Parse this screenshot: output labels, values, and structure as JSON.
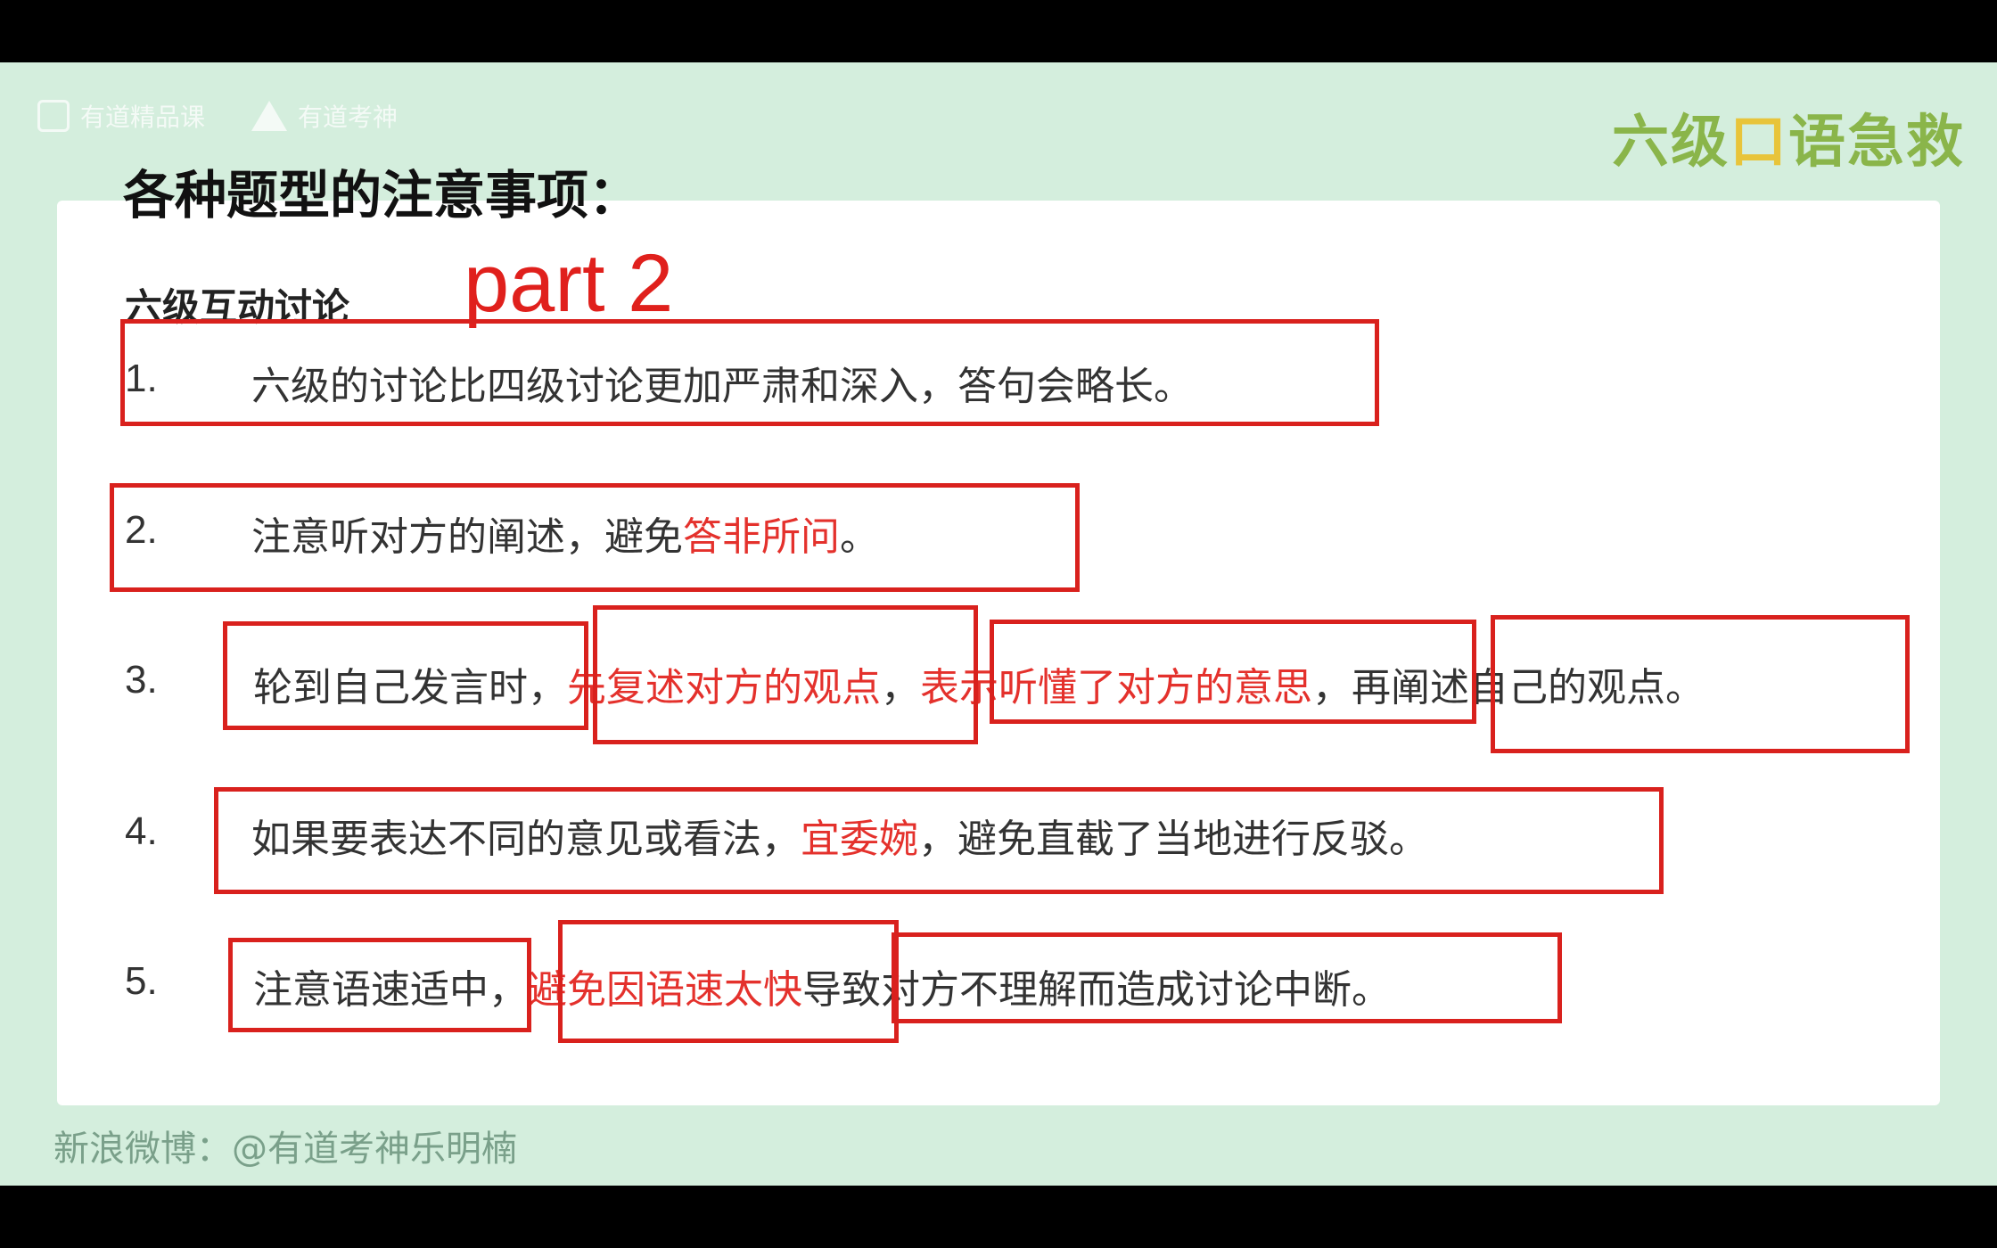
{
  "brand": {
    "youdao_course": "有道精品课",
    "youdao_teacher": "有道考神"
  },
  "logo": {
    "text_a": "六级",
    "text_b": "口",
    "text_c": "语急救"
  },
  "title": "各种题型的注意事项：",
  "subtitle": "六级互动讨论",
  "annotation": "part 2",
  "items": [
    {
      "num": "1.",
      "text": "六级的讨论比四级讨论更加严肃和深入，答句会略长。"
    },
    {
      "num": "2.",
      "text_a": "注意听对方的阐述，避免",
      "text_red": "答非所问",
      "text_b": "。"
    },
    {
      "num": "3.",
      "seg1": "轮到自己发言时，",
      "seg2": "先复述对方的观点",
      "sep": "，",
      "seg3": "表示听懂了对方的意思",
      "seg4": "，再阐述自己的观点。"
    },
    {
      "num": "4.",
      "text_a": "如果要表达不同的意见或看法，",
      "text_red": "宜委婉",
      "text_b": "，避免直截了当地进行反驳。"
    },
    {
      "num": "5.",
      "seg1": "注意语速适中，",
      "seg2": "避免因语速太快",
      "seg3": "导致对方不理解而造成讨论中断。"
    }
  ],
  "footer": "新浪微博：@有道考神乐明楠",
  "colors": {
    "accent_red": "#e4312c",
    "background": "#d4eedd"
  }
}
